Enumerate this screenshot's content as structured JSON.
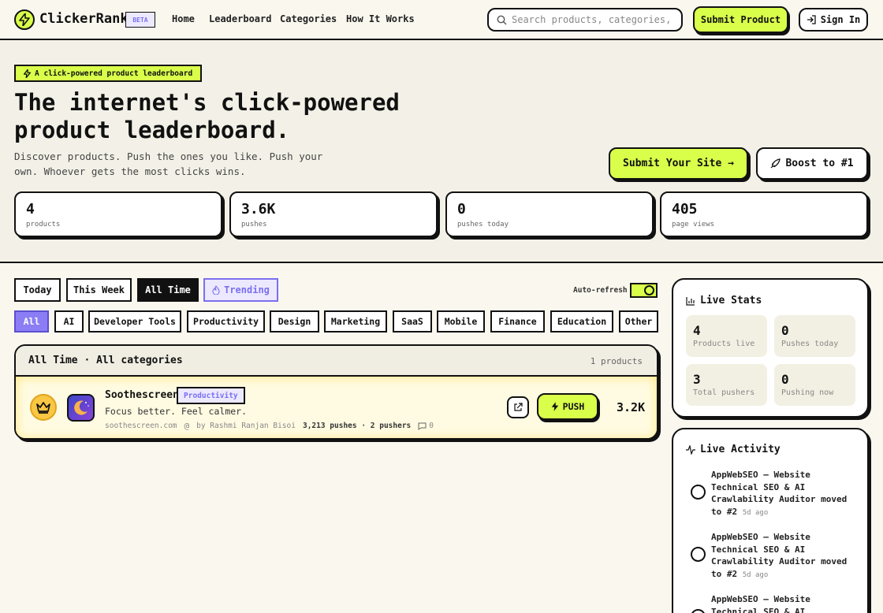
{
  "nav": {
    "brand": "ClickerRank",
    "beta": "BETA",
    "links": [
      "Home",
      "Leaderboard",
      "Categories",
      "How It Works"
    ],
    "search_placeholder": "Search products, categories, domains...",
    "submit_label": "Submit Product",
    "signin_label": "Sign In"
  },
  "hero": {
    "tagline": "A click-powered product leaderboard",
    "headline_line1": "The internet's click-powered",
    "headline_line2": "product leaderboard.",
    "subtext": "Discover products. Push the ones you like. Push your own. Whoever gets the most clicks wins.",
    "submit_site_label": "Submit Your Site →",
    "boost_label": "Boost to #1",
    "stats": [
      {
        "value": "4",
        "label": "products"
      },
      {
        "value": "3.6K",
        "label": "pushes"
      },
      {
        "value": "0",
        "label": "pushes today"
      },
      {
        "value": "405",
        "label": "page views"
      }
    ]
  },
  "filters": {
    "time": [
      "Today",
      "This Week",
      "All Time",
      "Trending"
    ],
    "active_time": "All Time",
    "auto_refresh_label": "Auto-refresh",
    "auto_refresh_on": true,
    "categories": [
      "All",
      "AI",
      "Developer Tools",
      "Productivity",
      "Design",
      "Marketing",
      "SaaS",
      "Mobile",
      "Finance",
      "Education",
      "Other"
    ],
    "active_category": "All"
  },
  "leaderboard": {
    "title": "All Time · All categories",
    "count_label": "1 products",
    "items": [
      {
        "rank": 1,
        "name": "Soothescreen",
        "category": "Productivity",
        "description": "Focus better. Feel calmer.",
        "domain": "soothescreen.com",
        "author": "by Rashmi Ranjan Bisoi",
        "pushes": "3,213 pushes",
        "pushers": "2 pushers",
        "comments": "0",
        "push_label": "PUSH",
        "score": "3.2K"
      }
    ]
  },
  "live_stats": {
    "title": "Live Stats",
    "items": [
      {
        "value": "4",
        "label": "Products live"
      },
      {
        "value": "0",
        "label": "Pushes today"
      },
      {
        "value": "3",
        "label": "Total pushers"
      },
      {
        "value": "0",
        "label": "Pushing now"
      }
    ]
  },
  "live_activity": {
    "title": "Live Activity",
    "items": [
      {
        "text": "AppWebSEO — Website Technical SEO & AI Crawlability Auditor moved to #2",
        "ago": "5d ago"
      },
      {
        "text": "AppWebSEO — Website Technical SEO & AI Crawlability Auditor moved to #2",
        "ago": "5d ago"
      },
      {
        "text": "AppWebSEO — Website Technical SEO & AI",
        "ago": ""
      }
    ]
  },
  "colors": {
    "accent": "#d9ff4a",
    "purple": "#8b7ef5",
    "background": "#faf7ef",
    "ink": "#111111"
  }
}
